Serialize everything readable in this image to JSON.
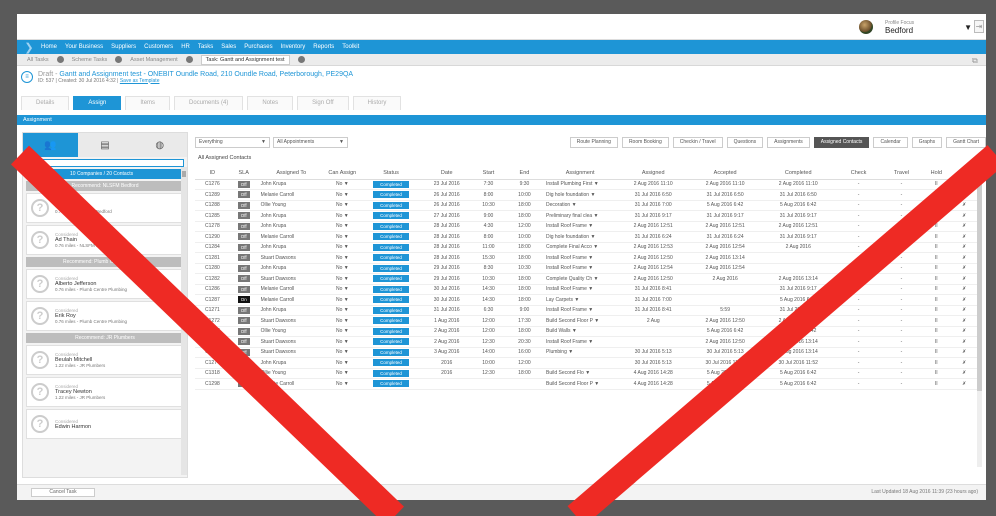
{
  "profile": {
    "small": "Profile Focus",
    "name": "Bedford"
  },
  "nav": [
    "Home",
    "Your Business",
    "Suppliers",
    "Customers",
    "HR",
    "Tasks",
    "Sales",
    "Purchases",
    "Inventory",
    "Reports",
    "Toolkit"
  ],
  "crumbs": [
    "All Tasks",
    "Scheme Tasks",
    "Asset Management",
    "Task: Gantt and Assignment test"
  ],
  "title": {
    "draft": "Draft -",
    "line1": "Gantt and Assignment test - ONEBIT",
    "address": "Oundle Road, 210 Oundle Road, Peterborough, PE29QA",
    "line2": "ID: 537 | Created: 30 Jul 2016 4:32 |",
    "save": "Save as Template"
  },
  "tabs": [
    "Details",
    "Assign",
    "Items",
    "Documents (4)",
    "Notes",
    "Sign Off",
    "History"
  ],
  "section": "Assignment",
  "left": {
    "header": "10 Companies / 20 Contacts",
    "bar0": "Recommend: NLSFM Bedford",
    "groups": [
      {
        "bar": "",
        "cards": [
          {
            "status": "",
            "name": "Rick E...",
            "dist": "0.76 miles - NLSFM Bedford"
          },
          {
            "status": "Considered",
            "name": "Ad Thain",
            "dist": "0.76 miles - NLSFM Bedford"
          }
        ]
      },
      {
        "bar": "Recommend: Plumb Centre Plumbing",
        "cards": [
          {
            "status": "Considered",
            "name": "Alberto Jefferson",
            "dist": "0.76 miles - Plumb Centre Plumbing"
          },
          {
            "status": "Considered",
            "name": "Erik Roy",
            "dist": "0.76 miles - Plumb Centre Plumbing"
          }
        ]
      },
      {
        "bar": "Recommend: JR Plumbers",
        "cards": [
          {
            "status": "Considered",
            "name": "Beulah Mitchell",
            "dist": "1.22 miles - JR Plumbers"
          },
          {
            "status": "Considered",
            "name": "Tracey Newton",
            "dist": "1.22 miles - JR Plumbers"
          },
          {
            "status": "Considered",
            "name": "Edwin Harmon",
            "dist": ""
          }
        ]
      }
    ]
  },
  "filters": {
    "f1": "Everything",
    "f2": "All Appointments",
    "buttons": [
      "Route Planning",
      "Room Booking",
      "Checkin / Travel",
      "Questions",
      "Assignments",
      "Assigned Contacts",
      "Calendar",
      "Graphs",
      "Gantt Chart"
    ],
    "active": "Assigned Contacts"
  },
  "all_contacts": "All Assigned Contacts",
  "columns": [
    "ID",
    "SLA",
    "Assigned To",
    "Can Assign",
    "Status",
    "Date",
    "Start",
    "End",
    "Assignment",
    "Assigned",
    "Accepted",
    "Completed",
    "Check",
    "Travel",
    "Hold",
    "X"
  ],
  "rows": [
    [
      "C1276",
      "Off",
      "John Krupa",
      "No",
      "Completed",
      "23 Jul 2016",
      "7:30",
      "9:30",
      "Install Plumbing First",
      "2 Aug 2016 11:10",
      "2 Aug 2016 11:10",
      "2 Aug 2016 11:10",
      "-",
      "-",
      "II",
      "✗"
    ],
    [
      "C1289",
      "Off",
      "Melanie Carroll",
      "No",
      "Completed",
      "26 Jul 2016",
      "8:00",
      "10:00",
      "Dig hole foundation",
      "31 Jul 2016 6:50",
      "31 Jul 2016 6:50",
      "31 Jul 2016 6:50",
      "-",
      "-",
      "II",
      "✗"
    ],
    [
      "C1288",
      "Off",
      "Ollie Young",
      "No",
      "Completed",
      "26 Jul 2016",
      "10:30",
      "18:00",
      "Decoration",
      "31 Jul 2016 7:00",
      "5 Aug 2016 6:42",
      "5 Aug 2016 6:42",
      "-",
      "-",
      "II",
      "✗"
    ],
    [
      "C1285",
      "Off",
      "John Krupa",
      "No",
      "Completed",
      "27 Jul 2016",
      "9:00",
      "18:00",
      "Preliminary final clea",
      "31 Jul 2016 9:17",
      "31 Jul 2016 9:17",
      "31 Jul 2016 9:17",
      "-",
      "-",
      "II",
      "✗"
    ],
    [
      "C1278",
      "Off",
      "John Krupa",
      "No",
      "Completed",
      "28 Jul 2016",
      "4:30",
      "12:00",
      "Install Roof Frame",
      "2 Aug 2016 12:51",
      "2 Aug 2016 12:51",
      "2 Aug 2016 12:51",
      "-",
      "-",
      "II",
      "✗"
    ],
    [
      "C1290",
      "Off",
      "Melanie Carroll",
      "No",
      "Completed",
      "28 Jul 2016",
      "8:00",
      "10:00",
      "Dig hole foundation",
      "31 Jul 2016 6:24",
      "31 Jul 2016 6:24",
      "31 Jul 2016 9:17",
      "-",
      "-",
      "II",
      "✗"
    ],
    [
      "C1284",
      "Off",
      "John Krupa",
      "No",
      "Completed",
      "28 Jul 2016",
      "11:00",
      "18:00",
      "Complete Final Acco",
      "2 Aug 2016 12:53",
      "2 Aug 2016 12:54",
      "2 Aug 2016",
      "-",
      "-",
      "II",
      "✗"
    ],
    [
      "C1281",
      "Off",
      "Stuart Dawsons",
      "No",
      "Completed",
      "28 Jul 2016",
      "15:30",
      "18:00",
      "Install Roof Frame",
      "2 Aug 2016 12:50",
      "2 Aug 2016 13:14",
      "",
      "-",
      "-",
      "II",
      "✗"
    ],
    [
      "C1280",
      "Off",
      "John Krupa",
      "No",
      "Completed",
      "29 Jul 2016",
      "8:30",
      "10:30",
      "Install Roof Frame",
      "2 Aug 2016 12:54",
      "2 Aug 2016 12:54",
      "",
      "-",
      "-",
      "II",
      "✗"
    ],
    [
      "C1282",
      "Off",
      "Stuart Dawsons",
      "No",
      "Completed",
      "29 Jul 2016",
      "10:30",
      "18:00",
      "Complete Quality Ch",
      "2 Aug 2016 12:50",
      "2 Aug 2016",
      "2 Aug 2016 13:14",
      "-",
      "-",
      "II",
      "✗"
    ],
    [
      "C1286",
      "Off",
      "Melanie Carroll",
      "No",
      "Completed",
      "30 Jul 2016",
      "14:30",
      "18:00",
      "Install Roof Frame",
      "31 Jul 2016 8:41",
      "",
      "31 Jul 2016 9:17",
      "-",
      "-",
      "II",
      "✗"
    ],
    [
      "C1287",
      "On",
      "Melanie Carroll",
      "No",
      "Completed",
      "30 Jul 2016",
      "14:30",
      "18:00",
      "Lay Carpets",
      "31 Jul 2016 7:00",
      "",
      "5 Aug 2016 6:42",
      "-",
      "-",
      "II",
      "✗"
    ],
    [
      "C1271",
      "Off",
      "John Krupa",
      "No",
      "Completed",
      "31 Jul 2016",
      "6:30",
      "9:00",
      "Install Roof Frame",
      "31 Jul 2016 8:41",
      "5:59",
      "31 Jul 2016 8:59",
      "-",
      "-",
      "II",
      "✗"
    ],
    [
      "C1272",
      "Off",
      "Stuart Dawsons",
      "No",
      "Completed",
      "1 Aug 2016",
      "12:00",
      "17:30",
      "Build Second Floor P",
      "2 Aug",
      "2 Aug 2016 12:50",
      "2 Aug 2016 13:14",
      "-",
      "-",
      "II",
      "✗"
    ],
    [
      "C1297",
      "Off",
      "Ollie Young",
      "No",
      "Completed",
      "2 Aug 2016",
      "12:00",
      "18:00",
      "Build Walls",
      "",
      "5 Aug 2016 6:42",
      "5 Aug 2016 6:42",
      "-",
      "-",
      "II",
      "✗"
    ],
    [
      "C1279",
      "Off",
      "Stuart Dawsons",
      "No",
      "Completed",
      "2 Aug 2016",
      "12:30",
      "20:30",
      "Install Roof Frame",
      "",
      "2 Aug 2016 12:50",
      "2 Aug 2016 13:14",
      "-",
      "-",
      "II",
      "✗"
    ],
    [
      "C1273",
      "Off",
      "Stuart Dawsons",
      "No",
      "Completed",
      "3 Aug 2016",
      "14:00",
      "16:00",
      "Plumbing",
      "30 Jul 2016 5:13",
      "30 Jul 2016 5:13",
      "2 Aug 2016 13:14",
      "-",
      "-",
      "II",
      "✗"
    ],
    [
      "C1274",
      "Off",
      "John Krupa",
      "No",
      "Completed",
      "2016",
      "10:00",
      "12:00",
      "",
      "30 Jul 2016 5:13",
      "30 Jul 2016 11:52",
      "30 Jul 2016 11:52",
      "-",
      "-",
      "II",
      "✗"
    ],
    [
      "C1318",
      "Off",
      "Ollie Young",
      "No",
      "Completed",
      "2016",
      "12:30",
      "18:00",
      "Build Second Flo",
      "4 Aug 2016 14:28",
      "5 Aug 2016 6:42",
      "5 Aug 2016 6:42",
      "-",
      "-",
      "II",
      "✗"
    ],
    [
      "C1298",
      "Off",
      "Melanie Carroll",
      "No",
      "Completed",
      "",
      "",
      "",
      "Build Second Floor P",
      "4 Aug 2016 14:28",
      "5 Aug 2016 6:42",
      "5 Aug 2016 6:42",
      "-",
      "-",
      "II",
      "✗"
    ]
  ],
  "footer": {
    "cancel": "Cancel Task",
    "updated": "Last Updated 18 Aug 2016 11:39 (23 hours ago)"
  },
  "colors": {
    "accent": "#1e95d6",
    "cross": "#ee2a24"
  }
}
